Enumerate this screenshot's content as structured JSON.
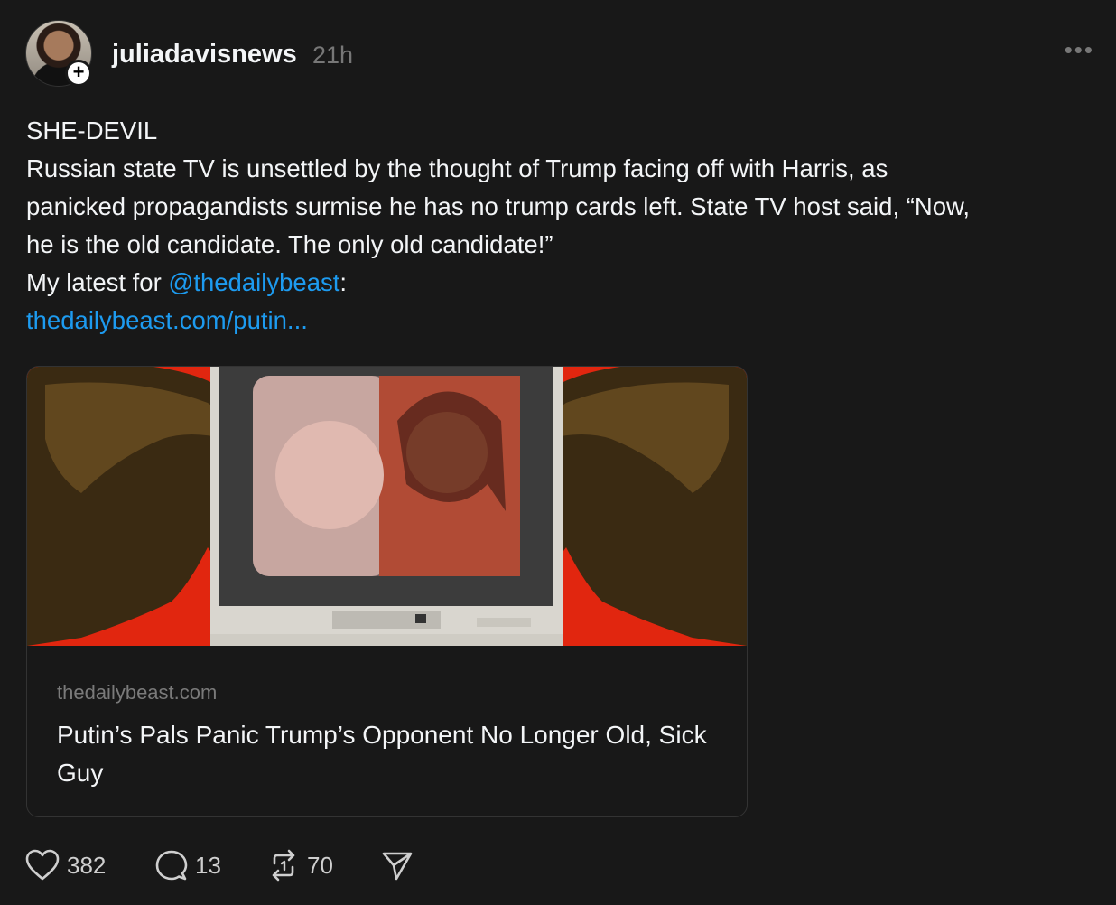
{
  "post": {
    "username": "juliadavisnews",
    "timestamp": "21h",
    "more_label": "•••",
    "follow_label": "+",
    "text_lines": [
      "SHE-DEVIL",
      "Russian state TV is unsettled by the thought of Trump facing off with Harris, as",
      "panicked propagandists surmise he has no trump cards left. State TV host said, “Now,",
      "he is the old candidate. The only old candidate!”"
    ],
    "latest_prefix": "My latest for ",
    "mention": "@thedailybeast",
    "latest_suffix": ":",
    "url": "thedailybeast.com/putin..."
  },
  "card": {
    "domain": "thedailybeast.com",
    "title": "Putin’s Pals Panic Trump’s Opponent No Longer Old, Sick Guy"
  },
  "actions": {
    "likes": "382",
    "replies": "13",
    "reposts": "70"
  },
  "colors": {
    "background": "#181818",
    "link": "#1d9bf0",
    "card_image_red": "#e1260f"
  }
}
